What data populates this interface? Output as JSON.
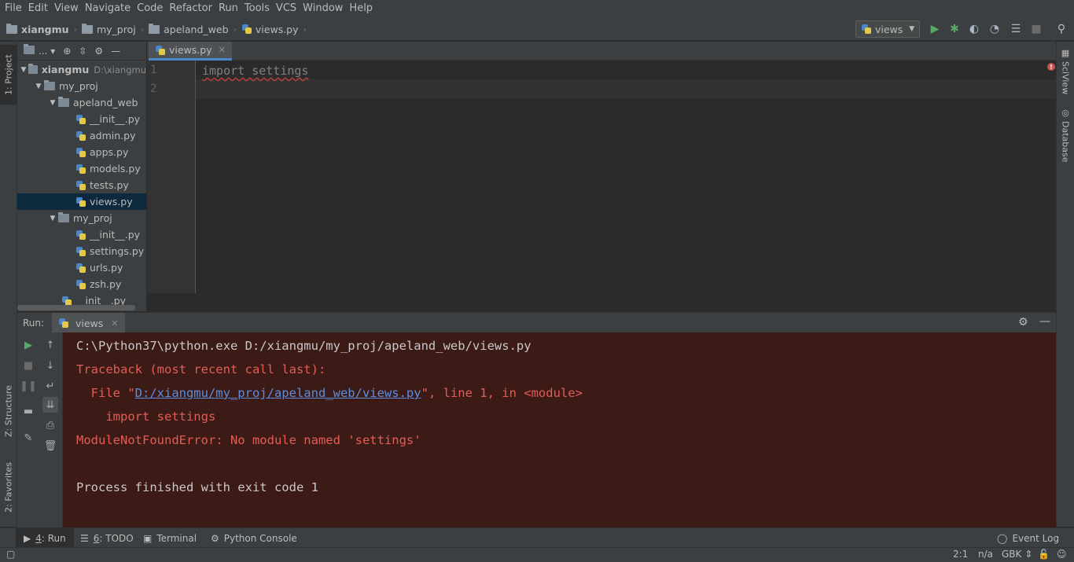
{
  "menu": [
    "File",
    "Edit",
    "View",
    "Navigate",
    "Code",
    "Refactor",
    "Run",
    "Tools",
    "VCS",
    "Window",
    "Help"
  ],
  "breadcrumb": [
    "xiangmu",
    "my_proj",
    "apeland_web",
    "views.py"
  ],
  "run_config": "views",
  "left_tabs": {
    "project": "1: Project",
    "structure": "Z: Structure",
    "favorites": "2: Favorites"
  },
  "right_tabs": {
    "sciview": "SciView",
    "database": "Database"
  },
  "project_toolbar": {
    "view_label": "..."
  },
  "tree": {
    "root": {
      "label": "xiangmu",
      "hint": "D:\\xiangmu"
    },
    "items": [
      {
        "label": "my_proj",
        "type": "folder"
      },
      {
        "label": "apeland_web",
        "type": "folder"
      },
      {
        "label": "__init__.py",
        "type": "py"
      },
      {
        "label": "admin.py",
        "type": "py"
      },
      {
        "label": "apps.py",
        "type": "py"
      },
      {
        "label": "models.py",
        "type": "py"
      },
      {
        "label": "tests.py",
        "type": "py"
      },
      {
        "label": "views.py",
        "type": "py",
        "selected": true
      },
      {
        "label": "my_proj",
        "type": "folder"
      },
      {
        "label": "__init__.py",
        "type": "py"
      },
      {
        "label": "settings.py",
        "type": "py"
      },
      {
        "label": "urls.py",
        "type": "py"
      },
      {
        "label": "zsh.py",
        "type": "py"
      },
      {
        "label": "__init__.py",
        "type": "py"
      }
    ]
  },
  "editor": {
    "tab": "views.py",
    "lines": [
      "import settings",
      ""
    ],
    "line_numbers": [
      "1",
      "2"
    ]
  },
  "run": {
    "label": "Run:",
    "tab": "views",
    "console": {
      "cmd": "C:\\Python37\\python.exe D:/xiangmu/my_proj/apeland_web/views.py",
      "traceback": "Traceback (most recent call last):",
      "file_prefix": "  File \"",
      "file_link": "D:/xiangmu/my_proj/apeland_web/views.py",
      "file_suffix": "\", line 1, in <module>",
      "code": "    import settings",
      "error": "ModuleNotFoundError: No module named 'settings'",
      "finished": "Process finished with exit code 1"
    }
  },
  "bottom_tabs": [
    {
      "num": "4",
      "label": ": Run"
    },
    {
      "num": "6",
      "label": ": TODO"
    },
    {
      "num": "",
      "label": "Terminal"
    },
    {
      "num": "",
      "label": "Python Console"
    }
  ],
  "event_log": "Event Log",
  "status": {
    "position": "2:1",
    "na": "n/a",
    "encoding": "GBK"
  },
  "colors": {
    "accent": "#4a88c7",
    "console_bg": "#3c1a16",
    "error_text": "#e35d56",
    "link": "#5c8ee0"
  }
}
